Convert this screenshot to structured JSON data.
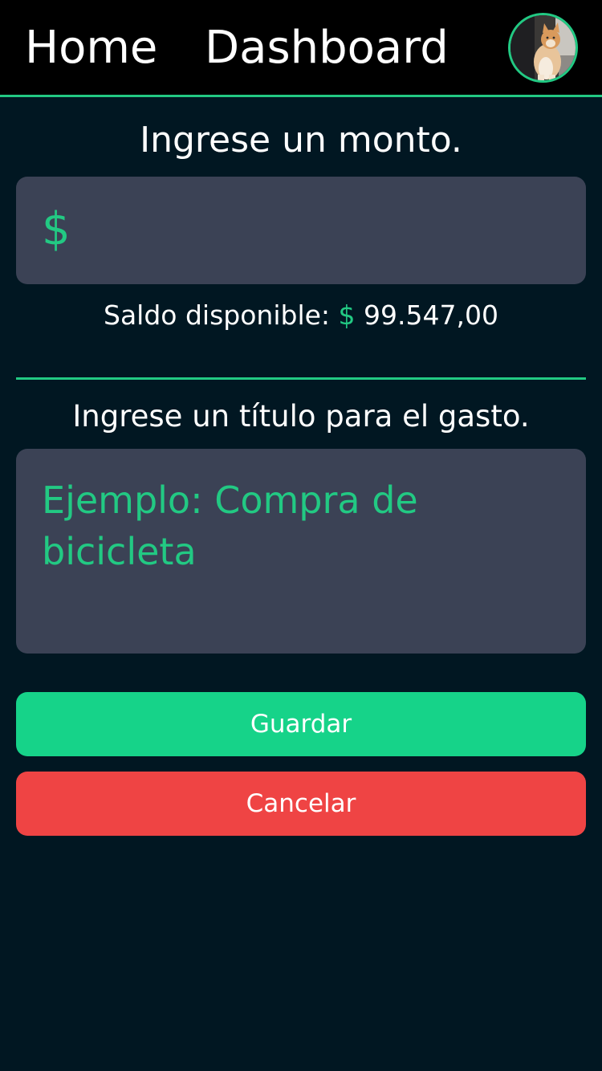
{
  "nav": {
    "home_label": "Home",
    "dashboard_label": "Dashboard",
    "avatar_icon": "user-avatar-cat-photo"
  },
  "amount": {
    "label": "Ingrese un monto.",
    "currency_symbol": "$",
    "value": "",
    "placeholder": ""
  },
  "balance": {
    "label": "Saldo disponible:",
    "currency_symbol": "$",
    "value": "99.547,00"
  },
  "title": {
    "label": "Ingrese un título para el gasto.",
    "value": "",
    "placeholder": "Ejemplo: Compra de bicicleta"
  },
  "actions": {
    "save_label": "Guardar",
    "cancel_label": "Cancelar"
  },
  "colors": {
    "accent": "#22c983",
    "save": "#16d389",
    "cancel": "#ef4444",
    "background": "#011722",
    "field": "#3b4255",
    "topbar": "#000000"
  }
}
